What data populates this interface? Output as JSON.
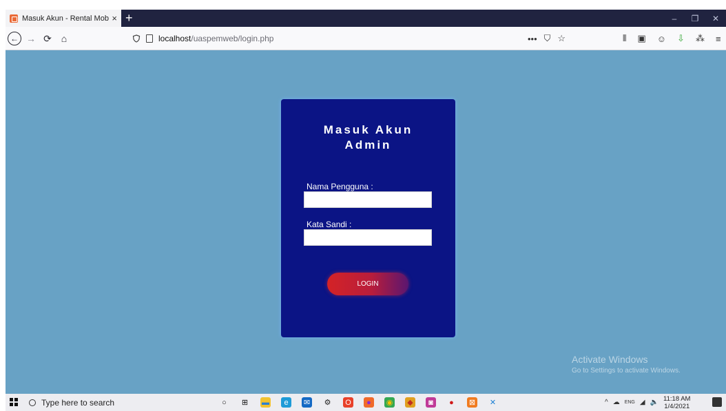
{
  "browser": {
    "tab_title": "Masuk Akun - Rental Mobil Ku",
    "tab_close": "×",
    "new_tab": "+",
    "window_controls": {
      "minimize": "–",
      "maximize": "❐",
      "close": "✕"
    },
    "nav": {
      "back": "←",
      "forward": "→",
      "reload": "⟳",
      "home": "⌂"
    },
    "url_host": "localhost",
    "url_path": "/uaspemweb/login.php",
    "url_actions": {
      "more": "•••",
      "pocket": "⛉",
      "bookmark": "☆"
    },
    "toolbar": {
      "library": "⫴",
      "sidebar": "▣",
      "account": "☺",
      "extension": "⇩",
      "extension2": "⁂",
      "menu": "≡"
    }
  },
  "login": {
    "title_line1": "Masuk Akun",
    "title_line2": "Admin",
    "username_label": "Nama Pengguna :",
    "username_value": "",
    "password_label": "Kata Sandi :",
    "password_value": "",
    "button_label": "LOGIN"
  },
  "watermark": {
    "line1": "Activate Windows",
    "line2": "Go to Settings to activate Windows."
  },
  "taskbar": {
    "search_placeholder": "Type here to search",
    "apps": [
      {
        "name": "cortana-icon",
        "glyph": "○",
        "color": "#ededf1",
        "text": "#111"
      },
      {
        "name": "task-view-icon",
        "glyph": "⊞",
        "color": "#ededf1",
        "text": "#111"
      },
      {
        "name": "file-explorer-icon",
        "glyph": "▬",
        "color": "#f2c230",
        "text": "#2a7fd4"
      },
      {
        "name": "edge-icon",
        "glyph": "e",
        "color": "#1e9bd7",
        "text": "#fff"
      },
      {
        "name": "mail-icon",
        "glyph": "✉",
        "color": "#1469c4",
        "text": "#fff"
      },
      {
        "name": "settings-icon",
        "glyph": "⚙",
        "color": "#ededf1",
        "text": "#222"
      },
      {
        "name": "office-icon",
        "glyph": "O",
        "color": "#e8412a",
        "text": "#fff"
      },
      {
        "name": "firefox-icon",
        "glyph": "●",
        "color": "#f06a2a",
        "text": "#8a2bd4"
      },
      {
        "name": "chrome-icon",
        "glyph": "◉",
        "color": "#34a853",
        "text": "#fbbc05"
      },
      {
        "name": "amongus-icon",
        "glyph": "◆",
        "color": "#e0a020",
        "text": "#c03020"
      },
      {
        "name": "picture-icon",
        "glyph": "◙",
        "color": "#c03a98",
        "text": "#fff"
      },
      {
        "name": "record-icon",
        "glyph": "●",
        "color": "#ededf1",
        "text": "#d01818"
      },
      {
        "name": "xampp-icon",
        "glyph": "⊠",
        "color": "#f07b20",
        "text": "#fff"
      },
      {
        "name": "vscode-icon",
        "glyph": "✕",
        "color": "#ededf1",
        "text": "#1a7fd4"
      }
    ],
    "tray": {
      "chevron": "^",
      "cloud": "☁",
      "language": "ENG",
      "wifi": "◢",
      "volume": "🔈"
    },
    "time": "11:18 AM",
    "date": "1/4/2021"
  }
}
